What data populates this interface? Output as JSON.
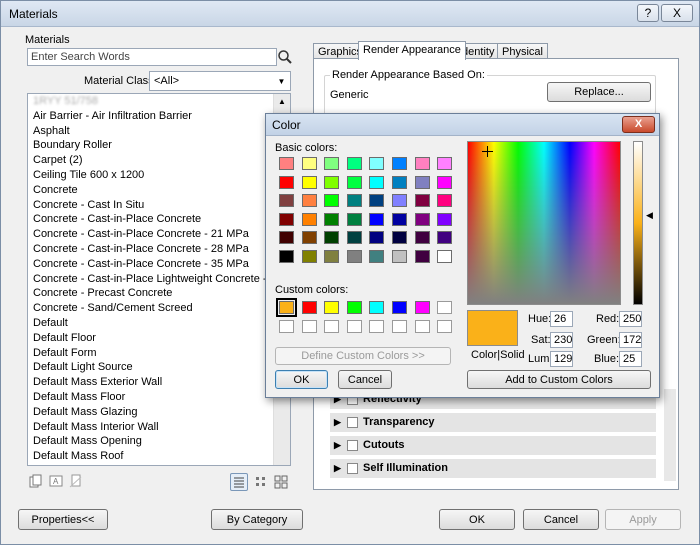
{
  "window": {
    "title": "Materials",
    "help_btn": "?",
    "close_btn": "X"
  },
  "left": {
    "section_label": "Materials",
    "search_placeholder": "Enter Search Words",
    "material_class_label": "Material Class:",
    "material_class_value": "<All>",
    "materials": [
      "Air Barrier - Air Infiltration Barrier",
      "Asphalt",
      "Boundary Roller",
      "Carpet (2)",
      "Ceiling Tile 600 x 1200",
      "Concrete",
      "Concrete - Cast In Situ",
      "Concrete - Cast-in-Place Concrete",
      "Concrete - Cast-in-Place Concrete - 21 MPa",
      "Concrete - Cast-in-Place Concrete - 28 MPa",
      "Concrete - Cast-in-Place Concrete - 35 MPa",
      "Concrete - Cast-in-Place Lightweight Concrete - 28 MPa",
      "Concrete - Precast Concrete",
      "Concrete - Sand/Cement Screed",
      "Default",
      "Default Floor",
      "Default Form",
      "Default Light Source",
      "Default Mass Exterior Wall",
      "Default Mass Floor",
      "Default Mass Glazing",
      "Default Mass Interior Wall",
      "Default Mass Opening",
      "Default Mass Roof"
    ]
  },
  "tabs": [
    "Graphics",
    "Render Appearance",
    "Identity",
    "Physical"
  ],
  "render": {
    "based_on_label": "Render Appearance Based On:",
    "based_on_value": "Generic",
    "replace_button": "Replace...",
    "sections": [
      "Reflectivity",
      "Transparency",
      "Cutouts",
      "Self Illumination"
    ]
  },
  "bottom": {
    "properties_button": "Properties<<",
    "by_category_button": "By Category",
    "ok_button": "OK",
    "cancel_button": "Cancel",
    "apply_button": "Apply"
  },
  "color_dialog": {
    "title": "Color",
    "close_btn": "X",
    "basic_colors_label": "Basic colors:",
    "custom_colors_label": "Custom colors:",
    "define_custom_button": "Define Custom Colors >>",
    "ok_button": "OK",
    "cancel_button": "Cancel",
    "color_solid_label": "Color|Solid",
    "add_custom_button": "Add to Custom Colors",
    "hue_label": "Hue:",
    "hue": "26",
    "sat_label": "Sat:",
    "sat": "230",
    "lum_label": "Lum:",
    "lum": "129",
    "red_label": "Red:",
    "red": "250",
    "green_label": "Green:",
    "green": "172",
    "blue_label": "Blue:",
    "blue": "25",
    "current_color": "#fab119",
    "basic_colors": [
      [
        "#ff8080",
        "#ffff80",
        "#80ff80",
        "#00ff80",
        "#80ffff",
        "#0080ff",
        "#ff80c0",
        "#ff80ff"
      ],
      [
        "#ff0000",
        "#ffff00",
        "#80ff00",
        "#00ff40",
        "#00ffff",
        "#0080c0",
        "#8080c0",
        "#ff00ff"
      ],
      [
        "#804040",
        "#ff8040",
        "#00ff00",
        "#008080",
        "#004080",
        "#8080ff",
        "#800040",
        "#ff0080"
      ],
      [
        "#800000",
        "#ff8000",
        "#008000",
        "#008040",
        "#0000ff",
        "#0000a0",
        "#800080",
        "#8000ff"
      ],
      [
        "#400000",
        "#804000",
        "#004000",
        "#004040",
        "#000080",
        "#000040",
        "#400040",
        "#400080"
      ],
      [
        "#000000",
        "#808000",
        "#808040",
        "#808080",
        "#408080",
        "#c0c0c0",
        "#400040",
        "#ffffff"
      ]
    ],
    "custom_colors": [
      [
        "#fab119",
        "#ff0000",
        "#ffff00",
        "#00ff00",
        "#00ffff",
        "#0000ff",
        "#ff00ff",
        "#ffffff"
      ],
      [
        "#ffffff",
        "#ffffff",
        "#ffffff",
        "#ffffff",
        "#ffffff",
        "#ffffff",
        "#ffffff",
        "#ffffff"
      ]
    ]
  }
}
